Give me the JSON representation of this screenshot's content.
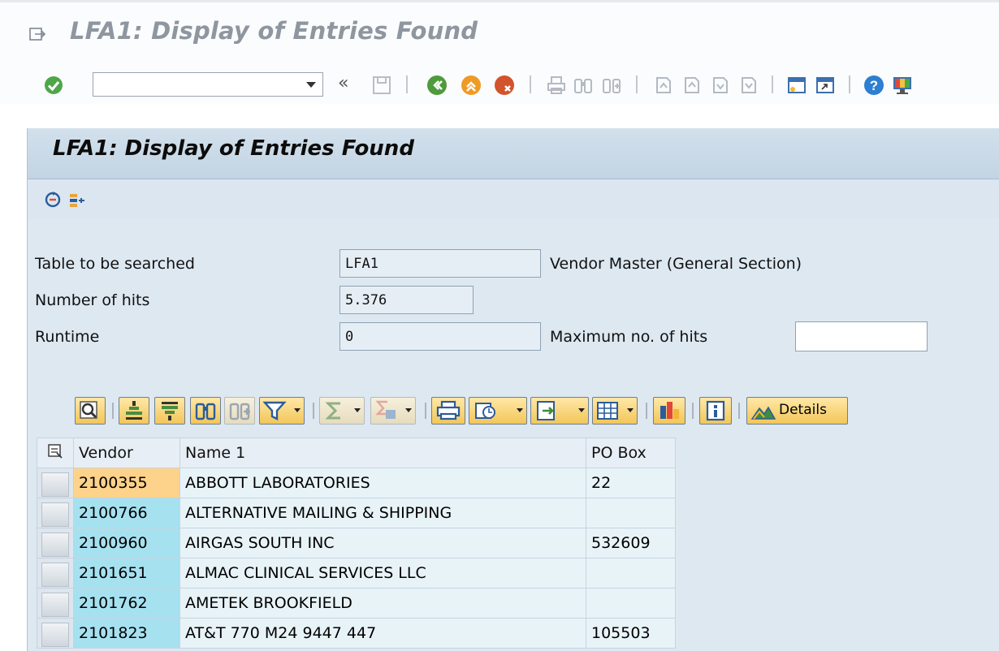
{
  "window": {
    "title": "LFA1: Display of Entries Found"
  },
  "toolbar": {
    "command_value": "",
    "icons": [
      "enter-icon",
      "command-dropdown-icon",
      "collapse-icon",
      "save-icon",
      "back-icon",
      "exit-icon",
      "cancel-icon",
      "print-icon",
      "find-icon",
      "find-next-icon",
      "first-page-icon",
      "previous-page-icon",
      "next-page-icon",
      "last-page-icon",
      "create-session-icon",
      "shortcut-icon",
      "help-icon",
      "customize-layout-icon"
    ],
    "collapse_glyph": "«"
  },
  "panel": {
    "title": "LFA1: Display of Entries Found",
    "app_icons": [
      "refresh-icon",
      "selection-criteria-icon"
    ]
  },
  "form": {
    "table_label": "Table to be searched",
    "table_value": "LFA1",
    "table_desc": "Vendor Master (General Section)",
    "hits_label": "Number of hits",
    "hits_value": "5.376",
    "runtime_label": "Runtime",
    "runtime_value": "0",
    "maxhits_label": "Maximum no. of hits",
    "maxhits_value": ""
  },
  "alv": {
    "details_label": "Details",
    "columns": [
      "Vendor",
      "Name 1",
      "PO Box"
    ],
    "rows": [
      {
        "vendor": "2100355",
        "name": "ABBOTT LABORATORIES",
        "pobox": "22"
      },
      {
        "vendor": "2100766",
        "name": "ALTERNATIVE MAILING & SHIPPING",
        "pobox": ""
      },
      {
        "vendor": "2100960",
        "name": "AIRGAS SOUTH INC",
        "pobox": "532609"
      },
      {
        "vendor": "2101651",
        "name": "ALMAC CLINICAL SERVICES LLC",
        "pobox": ""
      },
      {
        "vendor": "2101762",
        "name": "AMETEK BROOKFIELD",
        "pobox": ""
      },
      {
        "vendor": "2101823",
        "name": "AT&T  770 M24 9447 447",
        "pobox": "105503"
      }
    ]
  },
  "colors": {
    "accent": "#f2c659",
    "key_cell": "#a6e1f0",
    "focus_cell": "#fdd28a",
    "panel": "#dde8f1"
  }
}
